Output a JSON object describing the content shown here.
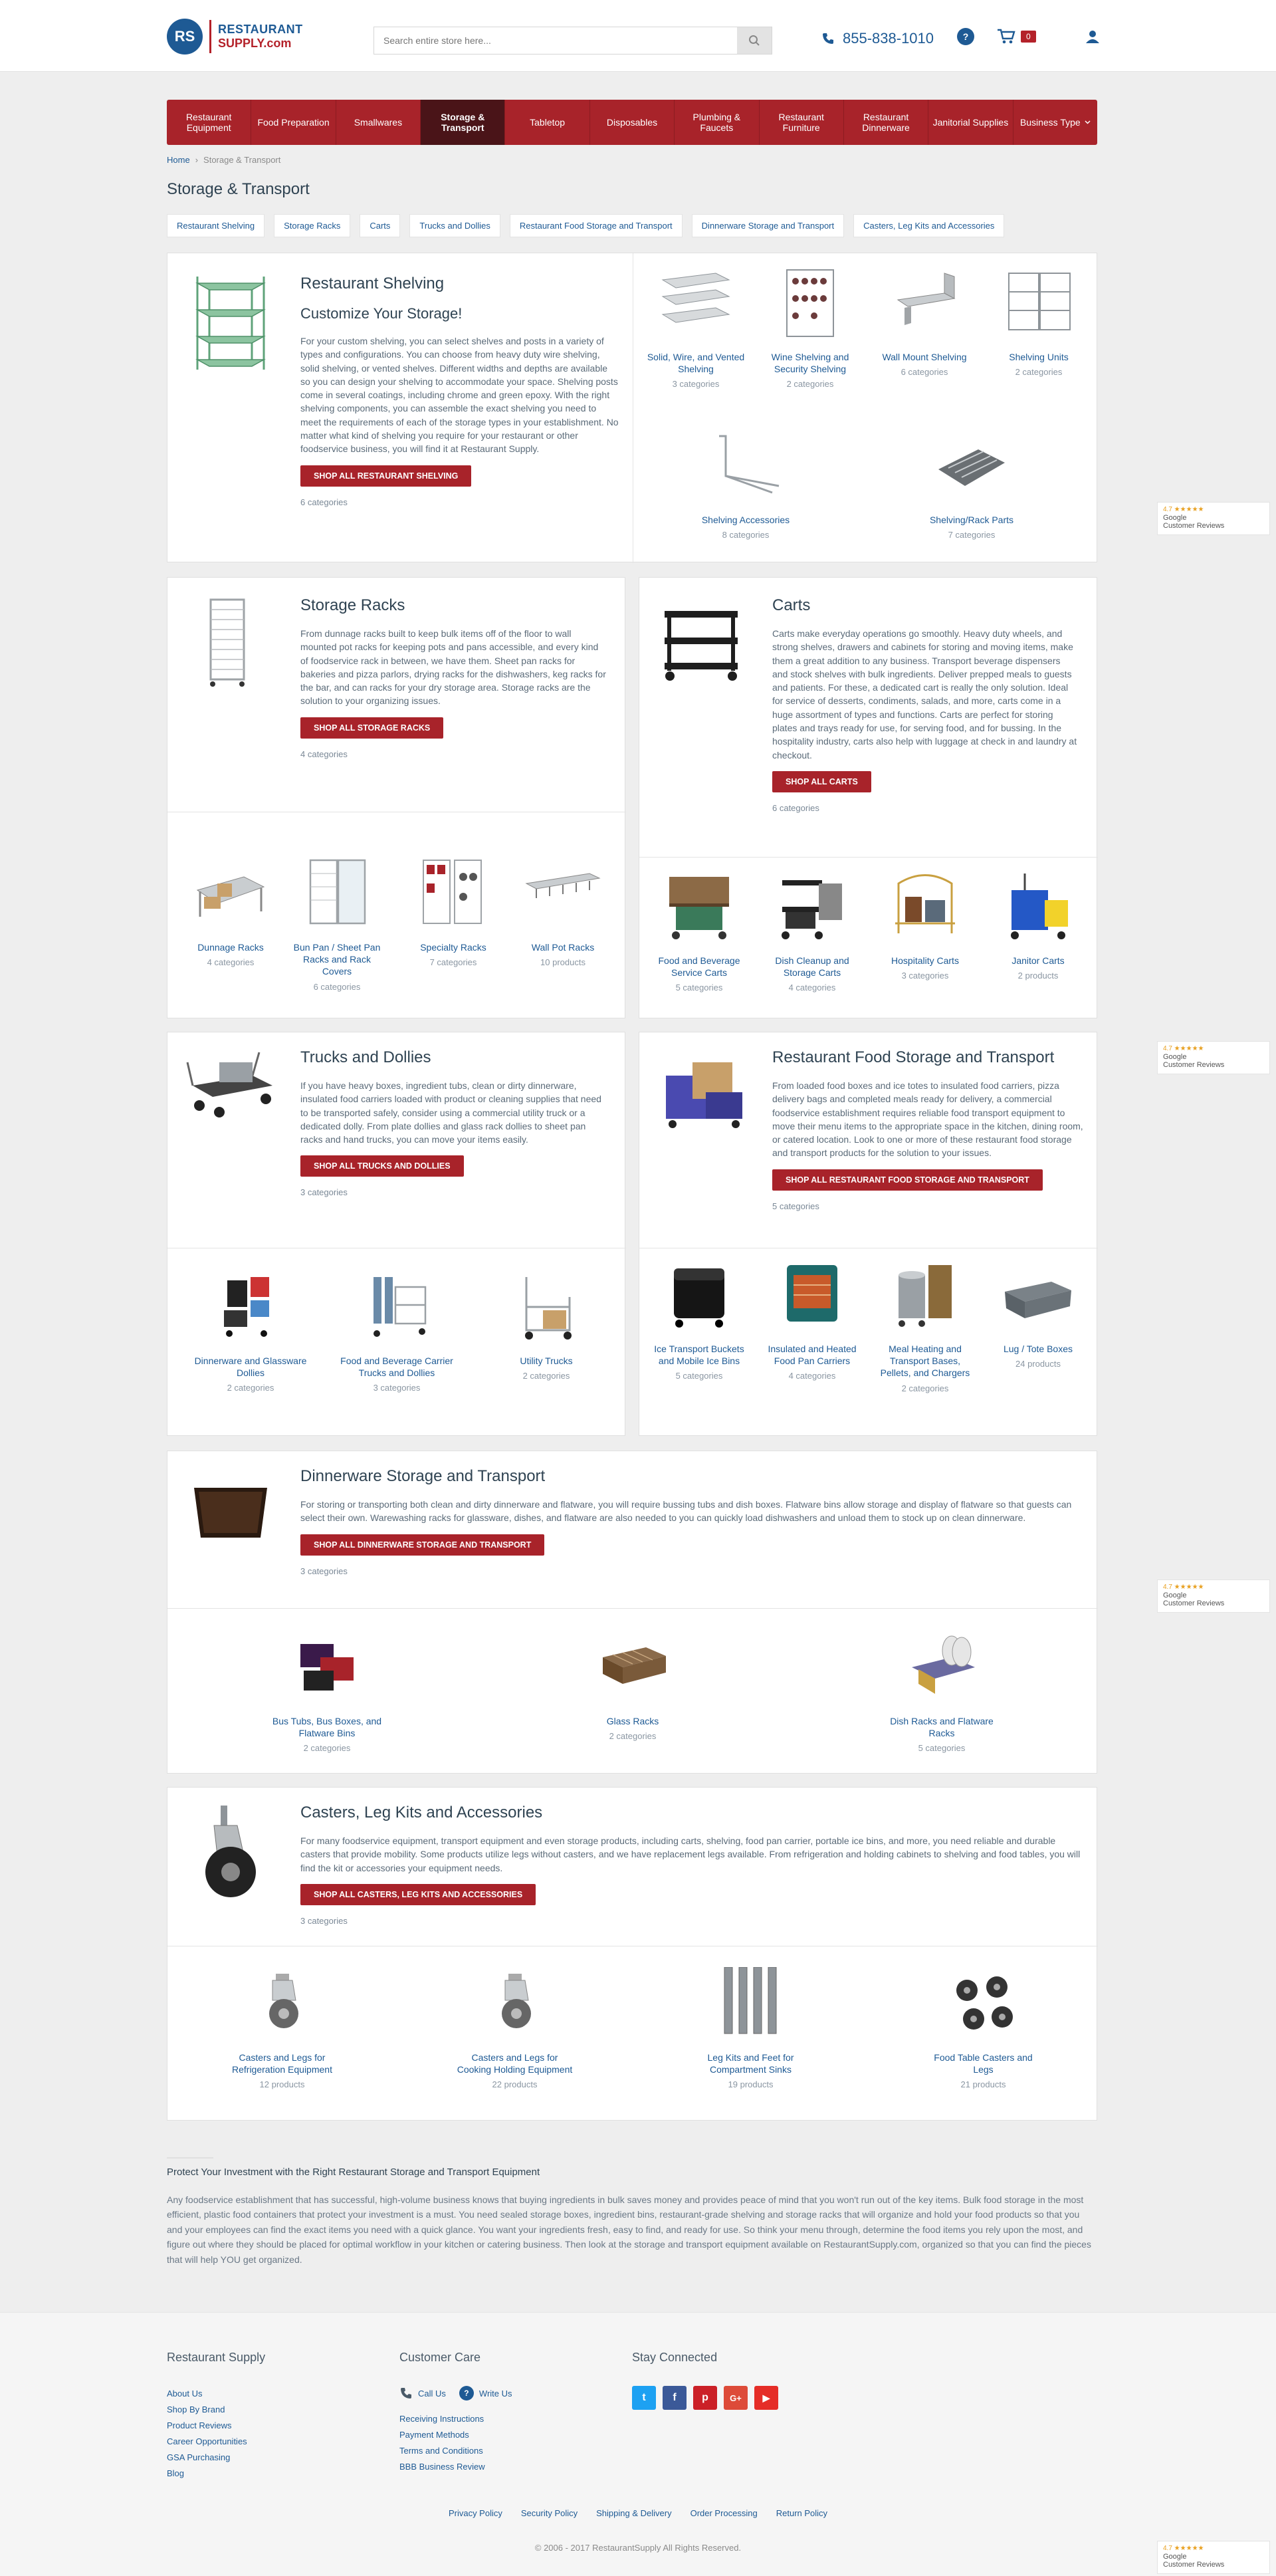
{
  "header": {
    "logo_mark": "RS",
    "logo_line1": "RESTAURANT",
    "logo_line2": "SUPPLY.com",
    "search_placeholder": "Search entire store here...",
    "phone": "855-838-1010",
    "chat_icon": "?",
    "cart_count": "0"
  },
  "nav": [
    "Restaurant Equipment",
    "Food Preparation",
    "Smallwares",
    "Storage & Transport",
    "Tabletop",
    "Disposables",
    "Plumbing & Faucets",
    "Restaurant Furniture",
    "Restaurant Dinnerware",
    "Janitorial Supplies",
    "Business Type"
  ],
  "breadcrumb": {
    "home": "Home",
    "current": "Storage & Transport"
  },
  "page_title": "Storage & Transport",
  "quick_links": [
    "Restaurant Shelving",
    "Storage Racks",
    "Carts",
    "Trucks and Dollies",
    "Restaurant Food Storage and Transport",
    "Dinnerware Storage and Transport",
    "Casters, Leg Kits and Accessories"
  ],
  "sections": {
    "shelving": {
      "title": "Restaurant Shelving",
      "subtitle": "Customize Your Storage!",
      "desc": "For your custom shelving, you can select shelves and posts in a variety of types and configurations. You can choose from heavy duty wire shelving, solid shelving, or vented shelves. Different widths and depths are available so you can design your shelving to accommodate your space. Shelving posts come in several coatings, including chrome and green epoxy. With the right shelving components, you can assemble the exact shelving you need to meet the requirements of each of the storage types in your establishment. No matter what kind of shelving you require for your restaurant or other foodservice business, you will find it at Restaurant Supply.",
      "button": "SHOP ALL RESTAURANT SHELVING",
      "count": "6 categories",
      "subs": [
        {
          "name": "Solid, Wire, and Vented Shelving",
          "count": "3 categories"
        },
        {
          "name": "Wine Shelving and Security Shelving",
          "count": "2 categories"
        },
        {
          "name": "Wall Mount Shelving",
          "count": "6 categories"
        },
        {
          "name": "Shelving Units",
          "count": "2 categories"
        },
        {
          "name": "Shelving Accessories",
          "count": "8 categories"
        },
        {
          "name": "Shelving/Rack Parts",
          "count": "7 categories"
        }
      ]
    },
    "racks": {
      "title": "Storage Racks",
      "desc": "From dunnage racks built to keep bulk items off of the floor to wall mounted pot racks for keeping pots and pans accessible, and every kind of foodservice rack in between, we have them. Sheet pan racks for bakeries and pizza parlors, drying racks for the dishwashers, keg racks for the bar, and can racks for your dry storage area. Storage racks are the solution to your organizing issues.",
      "button": "SHOP ALL STORAGE RACKS",
      "count": "4 categories",
      "subs": [
        {
          "name": "Dunnage Racks",
          "count": "4 categories"
        },
        {
          "name": "Bun Pan / Sheet Pan Racks and Rack Covers",
          "count": "6 categories"
        },
        {
          "name": "Specialty Racks",
          "count": "7 categories"
        },
        {
          "name": "Wall Pot Racks",
          "count": "10 products"
        }
      ]
    },
    "carts": {
      "title": "Carts",
      "desc": "Carts make everyday operations go smoothly. Heavy duty wheels, and strong shelves, drawers and cabinets for storing and moving items, make them a great addition to any business. Transport beverage dispensers and stock shelves with bulk ingredients. Deliver prepped meals to guests and patients. For these, a dedicated cart is really the only solution. Ideal for service of desserts, condiments, salads, and more, carts come in a huge assortment of types and functions. Carts are perfect for storing plates and trays ready for use, for serving food, and for bussing. In the hospitality industry, carts also help with luggage at check in and laundry at checkout.",
      "button": "SHOP ALL CARTS",
      "count": "6 categories",
      "subs": [
        {
          "name": "Food and Beverage Service Carts",
          "count": "5 categories"
        },
        {
          "name": "Dish Cleanup and Storage Carts",
          "count": "4 categories"
        },
        {
          "name": "Hospitality Carts",
          "count": "3 categories"
        },
        {
          "name": "Janitor Carts",
          "count": "2 products"
        }
      ]
    },
    "trucks": {
      "title": "Trucks and Dollies",
      "desc": "If you have heavy boxes, ingredient tubs, clean or dirty dinnerware, insulated food carriers loaded with product or cleaning supplies that need to be transported safely, consider using a commercial utility truck or a dedicated dolly. From plate dollies and glass rack dollies to sheet pan racks and hand trucks, you can move your items easily.",
      "button": "SHOP ALL TRUCKS AND DOLLIES",
      "count": "3 categories",
      "subs": [
        {
          "name": "Dinnerware and Glassware Dollies",
          "count": "2 categories"
        },
        {
          "name": "Food and Beverage Carrier Trucks and Dollies",
          "count": "3 categories"
        },
        {
          "name": "Utility Trucks",
          "count": "2 categories"
        }
      ]
    },
    "foodstorage": {
      "title": "Restaurant Food Storage and Transport",
      "desc": "From loaded food boxes and ice totes to insulated food carriers, pizza delivery bags and completed meals ready for delivery, a commercial foodservice establishment requires reliable food transport equipment to move their menu items to the appropriate space in the kitchen, dining room, or catered location. Look to one or more of these restaurant food storage and transport products for the solution to your issues.",
      "button": "SHOP ALL RESTAURANT FOOD STORAGE AND TRANSPORT",
      "count": "5 categories",
      "subs": [
        {
          "name": "Ice Transport Buckets and Mobile Ice Bins",
          "count": "5 categories"
        },
        {
          "name": "Insulated and Heated Food Pan Carriers",
          "count": "4 categories"
        },
        {
          "name": "Meal Heating and Transport Bases, Pellets, and Chargers",
          "count": "2 categories"
        },
        {
          "name": "Lug / Tote Boxes",
          "count": "24 products"
        }
      ]
    },
    "dinnerware": {
      "title": "Dinnerware Storage and Transport",
      "desc": "For storing or transporting both clean and dirty dinnerware and flatware, you will require bussing tubs and dish boxes. Flatware bins allow storage and display of flatware so that guests can select their own. Warewashing racks for glassware, dishes, and flatware are also needed to you can quickly load dishwashers and unload them to stock up on clean dinnerware.",
      "button": "SHOP ALL DINNERWARE STORAGE AND TRANSPORT",
      "count": "3 categories",
      "subs": [
        {
          "name": "Bus Tubs, Bus Boxes, and Flatware Bins",
          "count": "2 categories"
        },
        {
          "name": "Glass Racks",
          "count": "2 categories"
        },
        {
          "name": "Dish Racks and Flatware Racks",
          "count": "5 categories"
        }
      ]
    },
    "casters": {
      "title": "Casters, Leg Kits and Accessories",
      "desc": "For many foodservice equipment, transport equipment and even storage products, including carts, shelving, food pan carrier, portable ice bins, and more, you need reliable and durable casters that provide mobility. Some products utilize legs without casters, and we have replacement legs available. From refrigeration and holding cabinets to shelving and food tables, you will find the kit or accessories your equipment needs.",
      "button": "SHOP ALL CASTERS, LEG KITS AND ACCESSORIES",
      "count": "3 categories",
      "subs": [
        {
          "name": "Casters and Legs for Refrigeration Equipment",
          "count": "12 products"
        },
        {
          "name": "Casters and Legs for Cooking Holding Equipment",
          "count": "22 products"
        },
        {
          "name": "Leg Kits and Feet for Compartment Sinks",
          "count": "19 products"
        },
        {
          "name": "Food Table Casters and Legs",
          "count": "21 products"
        }
      ]
    }
  },
  "seo": {
    "heading": "Protect Your Investment with the Right Restaurant Storage and Transport Equipment",
    "body": "Any foodservice establishment that has successful, high-volume business knows that buying ingredients in bulk saves money and provides peace of mind that you won't run out of the key items. Bulk food storage in the most efficient, plastic food containers that protect your investment is a must. You need sealed storage boxes, ingredient bins, restaurant-grade shelving and storage racks that will organize and hold your food products so that you and your employees can find the exact items you need with a quick glance. You want your ingredients fresh, easy to find, and ready for use. So think your menu through, determine the food items you rely upon the most, and figure out where they should be placed for optimal workflow in your kitchen or catering business. Then look at the storage and transport equipment available on RestaurantSupply.com, organized so that you can find the pieces that will help YOU get organized."
  },
  "footer": {
    "col1_title": "Restaurant Supply",
    "col1_links": [
      "About Us",
      "Shop By Brand",
      "Product Reviews",
      "Career Opportunities",
      "GSA Purchasing",
      "Blog"
    ],
    "col2_title": "Customer Care",
    "call": "Call Us",
    "write": "Write Us",
    "col2_links": [
      "Receiving Instructions",
      "Payment Methods",
      "Terms and Conditions",
      "BBB Business Review"
    ],
    "col3_title": "Stay Connected",
    "social": [
      "t",
      "f",
      "p",
      "G+",
      "▶"
    ],
    "bottom_links": [
      "Privacy Policy",
      "Security Policy",
      "Shipping & Delivery",
      "Order Processing",
      "Return Policy"
    ],
    "copyright": "© 2006 - 2017 RestaurantSupply All Rights Reserved."
  },
  "review_badge": {
    "rating": "4.7 ★★★★★",
    "line1": "Google",
    "line2": "Customer Reviews"
  },
  "colors": {
    "brand_blue": "#1e5a94",
    "brand_red": "#a8232a",
    "active_nav": "#4a1418"
  }
}
